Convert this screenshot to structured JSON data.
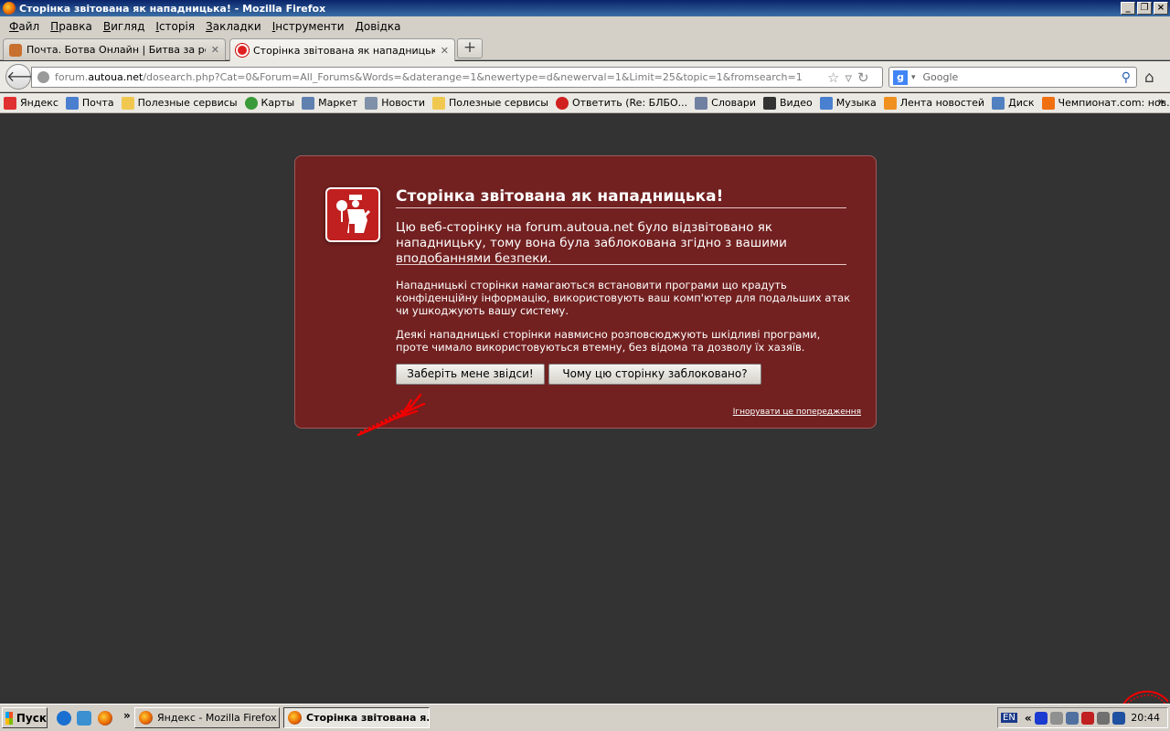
{
  "window": {
    "title": "Сторінка звітована як нападницька! - Mozilla Firefox"
  },
  "menu": [
    "Файл",
    "Правка",
    "Вигляд",
    "Історія",
    "Закладки",
    "Інструменти",
    "Довідка"
  ],
  "tabs": [
    {
      "label": "Почта. Ботва Онлайн | Битва за реаль..."
    },
    {
      "label": "Сторінка звітована як нападницька!"
    }
  ],
  "nav": {
    "url_prefix": "forum.",
    "url_domain": "autoua.net",
    "url_path": "/dosearch.php?Cat=0&Forum=All_Forums&Words=&daterange=1&newertype=d&newerval=1&Limit=25&topic=1&fromsearch=1",
    "search_placeholder": "Google"
  },
  "bookmarks": [
    {
      "label": "Яндекс",
      "color": "#e03030"
    },
    {
      "label": "Почта",
      "color": "#4a7fd0"
    },
    {
      "label": "Полезные сервисы",
      "color": "#f0c850"
    },
    {
      "label": "Карты",
      "color": "#3a9a3a"
    },
    {
      "label": "Маркет",
      "color": "#6080b0"
    },
    {
      "label": "Новости",
      "color": "#8090a8"
    },
    {
      "label": "Полезные сервисы",
      "color": "#f0c850"
    },
    {
      "label": "Ответить (Re: БЛБО...",
      "color": "#d02020"
    },
    {
      "label": "Словари",
      "color": "#7080a0"
    },
    {
      "label": "Видео",
      "color": "#333333"
    },
    {
      "label": "Музыка",
      "color": "#4a80d0"
    },
    {
      "label": "Лента новостей",
      "color": "#f09020"
    },
    {
      "label": "Диск",
      "color": "#5080c0"
    },
    {
      "label": "Чемпионат.com: нов...",
      "color": "#f07010"
    }
  ],
  "error": {
    "title": "Сторінка звітована як нападницька!",
    "description": "Цю веб-сторінку на forum.autoua.net було відзвітовано як нападницьку, тому вона була заблокована згідно з вашими вподобаннями безпеки.",
    "para1": "Нападницькі сторінки намагаються встановити програми що крадуть конфіденційну інформацію, використовують ваш комп'ютер для подальших атак чи ушкоджують вашу систему.",
    "para2": "Деякі нападницькі сторінки навмисно розповсюджують шкідливі програми, проте чимало використовуються втемну, без відома та дозволу їх хазяїв.",
    "button_get_me_out": "Заберіть мене звідси!",
    "button_why_blocked": "Чому цю сторінку заблоковано?",
    "ignore_link": "Ігнорувати це попередження"
  },
  "taskbar": {
    "start": "Пуск",
    "tasks": [
      {
        "label": "Яндекс - Mozilla Firefox"
      },
      {
        "label": "Сторінка звітована я..."
      }
    ],
    "lang": "EN",
    "clock": "20:44"
  }
}
